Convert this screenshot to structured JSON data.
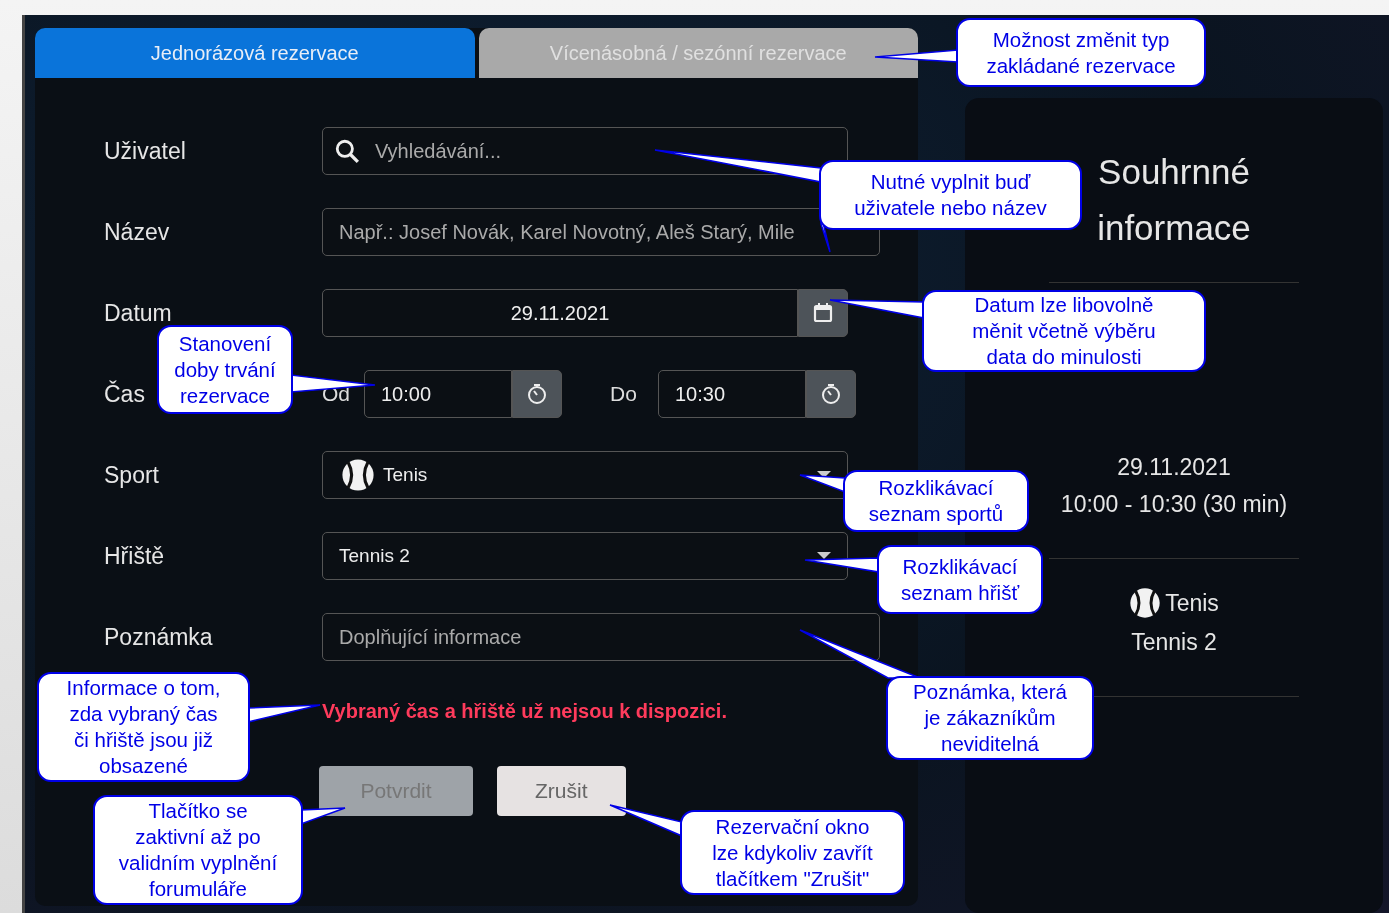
{
  "tabs": [
    {
      "label": "Jednorázová rezervace",
      "selected": true
    },
    {
      "label": "Vícenásobná / sezónní rezervace",
      "selected": false
    }
  ],
  "fields": [
    {
      "kind": "search",
      "label": "Uživatel",
      "placeholder": "Vyhledávání..."
    },
    {
      "kind": "text",
      "label": "Název",
      "placeholder": "Např.: Josef Novák, Karel Novotný, Aleš Starý, Mile"
    },
    {
      "kind": "date",
      "label": "Datum",
      "value": "29.11.2021"
    },
    {
      "kind": "time_range",
      "label": "Čas",
      "from_label": "Od",
      "from": "10:00",
      "to_label": "Do",
      "to": "10:30"
    },
    {
      "kind": "sport_select",
      "label": "Sport",
      "value": "Tenis"
    },
    {
      "kind": "select",
      "label": "Hřiště",
      "value": "Tennis 2"
    },
    {
      "kind": "text",
      "label": "Poznámka",
      "placeholder": "Doplňující informace"
    }
  ],
  "error": "Vybraný čas a hřiště už nejsou k dispozici.",
  "buttons": [
    {
      "label": "Potvrdit",
      "disabled": true
    },
    {
      "label": "Zrušit",
      "disabled": false
    }
  ],
  "summary": {
    "title": "Souhrnné informace",
    "date": "29.11.2021",
    "time": "10:00 - 10:30 (30 min)",
    "sport": "Tenis",
    "court": "Tennis 2"
  },
  "callouts": [
    {
      "lines": [
        "Možnost změnit typ",
        "zakládané rezervace"
      ]
    },
    {
      "lines": [
        "Nutné vyplnit buď",
        "uživatele nebo název"
      ]
    },
    {
      "lines": [
        "Datum lze libovolně",
        "měnit včetně výběru",
        "data do minulosti"
      ]
    },
    {
      "lines": [
        "Stanovení",
        "doby trvání",
        "rezervace"
      ]
    },
    {
      "lines": [
        "Rozklikávací",
        "seznam sportů"
      ]
    },
    {
      "lines": [
        "Rozklikávací",
        "seznam hřišť"
      ]
    },
    {
      "lines": [
        "Informace o tom,",
        "zda vybraný čas",
        "či hřiště jsou již",
        "obsazené"
      ]
    },
    {
      "lines": [
        "Poznámka, která",
        "je zákazníkům",
        "neviditelná"
      ]
    },
    {
      "lines": [
        "Tlačítko se",
        "zaktivní až po",
        "validním vyplnění",
        "forumuláře"
      ]
    },
    {
      "lines": [
        "Rezervační okno",
        "lze kdykoliv zavřít",
        "tlačítkem \"Zrušit\""
      ]
    }
  ]
}
